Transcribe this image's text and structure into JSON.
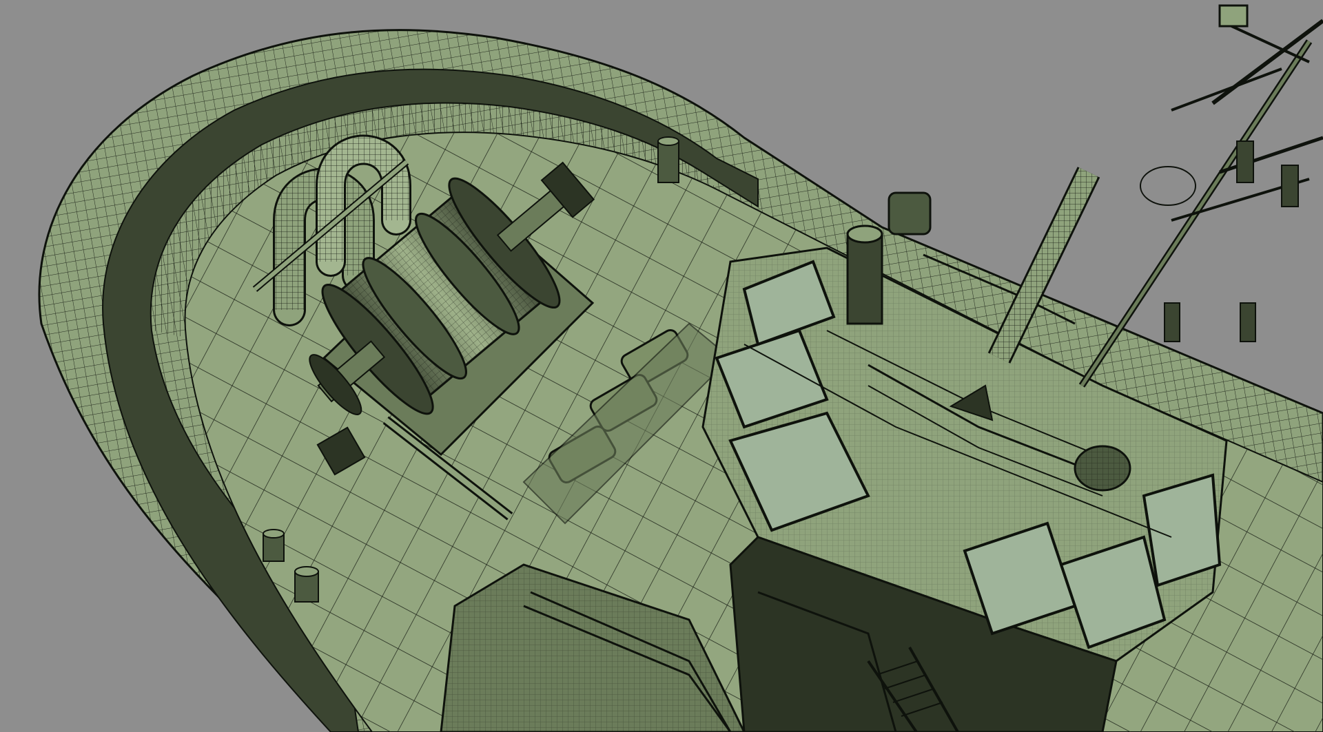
{
  "viewport": {
    "background_color": "#8e8e8e",
    "model_fill_color": "#8fa37c",
    "model_light_color": "#a3b690",
    "model_shadow_color": "#2c3424",
    "wireframe_color": "#0e120c",
    "glass_color": "#9fb49a"
  },
  "icons": [
    "winch-drum",
    "mooring-pipe",
    "bollard",
    "hatch",
    "mast",
    "searchlight",
    "wheelhouse-window",
    "railing",
    "ladder"
  ]
}
